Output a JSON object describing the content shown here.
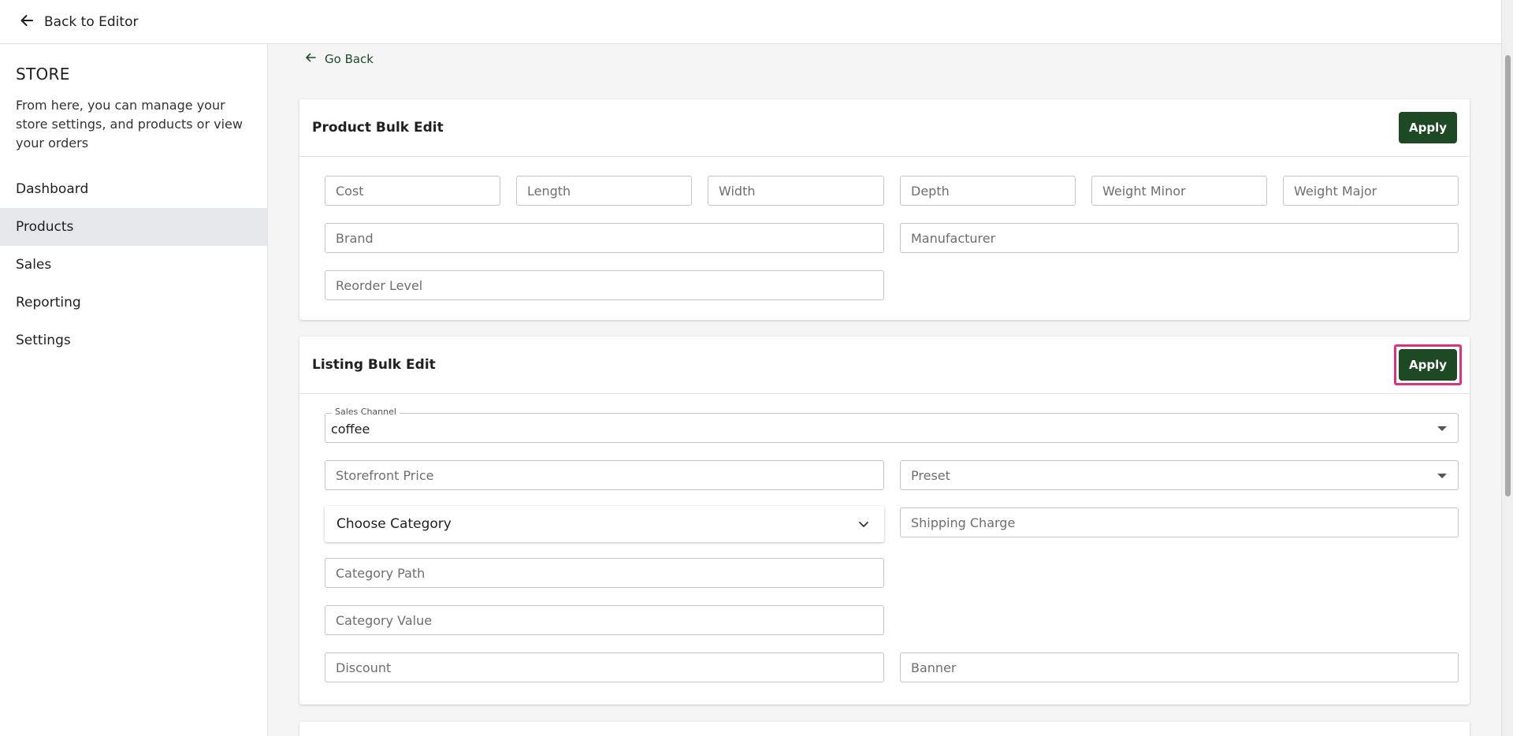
{
  "topbar": {
    "back_label": "Back to Editor"
  },
  "sidebar": {
    "title": "STORE",
    "description": "From here, you can manage your store settings, and products or view your orders",
    "items": [
      {
        "label": "Dashboard",
        "active": false
      },
      {
        "label": "Products",
        "active": true
      },
      {
        "label": "Sales",
        "active": false
      },
      {
        "label": "Reporting",
        "active": false
      },
      {
        "label": "Settings",
        "active": false
      }
    ]
  },
  "main": {
    "go_back_label": "Go Back"
  },
  "product_bulk_edit": {
    "title": "Product Bulk Edit",
    "apply_label": "Apply",
    "fields": {
      "cost": "Cost",
      "length": "Length",
      "width": "Width",
      "depth": "Depth",
      "weight_minor": "Weight Minor",
      "weight_major": "Weight Major",
      "brand": "Brand",
      "manufacturer": "Manufacturer",
      "reorder_level": "Reorder Level"
    }
  },
  "listing_bulk_edit": {
    "title": "Listing Bulk Edit",
    "apply_label": "Apply",
    "sales_channel": {
      "label": "Sales Channel",
      "value": "coffee"
    },
    "storefront_price": "Storefront Price",
    "preset": "Preset",
    "choose_category": "Choose Category",
    "shipping_charge": "Shipping Charge",
    "category_path": "Category Path",
    "category_value": "Category Value",
    "discount": "Discount",
    "banner": "Banner"
  },
  "colors": {
    "accent": "#1d4a25",
    "highlight": "#e0307a",
    "link": "#1e4a2a"
  }
}
